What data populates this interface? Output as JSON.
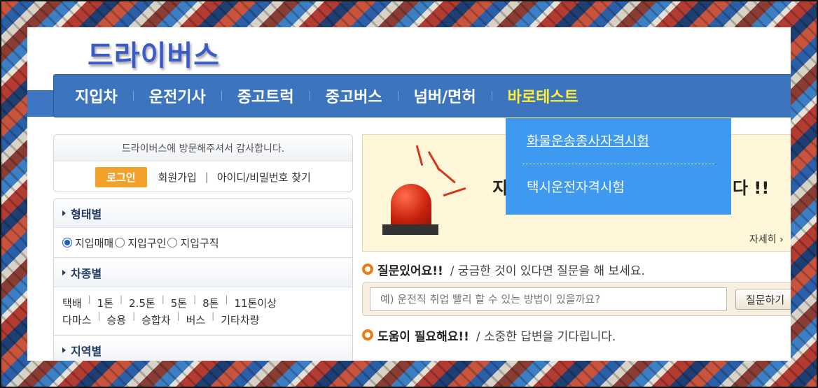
{
  "site": {
    "logo": "드라이버스"
  },
  "nav": {
    "items": [
      "지입차",
      "운전기사",
      "중고트럭",
      "중고버스",
      "넘버/면허",
      "바로테스트"
    ]
  },
  "dropdown": {
    "items": [
      "화물운송종사자격시험",
      "택시운전자격시험"
    ]
  },
  "welcome": {
    "message": "드라이버스에 방문해주셔서 감사합니다.",
    "login": "로그인",
    "join": "회원가입",
    "separator": "|",
    "find": "아이디/비밀번호 찾기"
  },
  "filters": {
    "type_heading": "형태별",
    "type_options": [
      {
        "label": "지입매매",
        "selected": true
      },
      {
        "label": "지입구인",
        "selected": false
      },
      {
        "label": "지입구직",
        "selected": false
      }
    ],
    "vehicle_heading": "차종별",
    "vehicle_row1": [
      "택배",
      "1톤",
      "2.5톤",
      "5톤",
      "8톤",
      "11톤이상"
    ],
    "vehicle_row2": [
      "다마스",
      "승용",
      "승합차",
      "버스",
      "기타차량"
    ],
    "region_heading": "지역별"
  },
  "banner": {
    "title_start": "지",
    "title_end": "다 !!",
    "detail": "자세히 ›"
  },
  "question": {
    "title": "질문있어요!!",
    "desc": "/ 궁금한 것이 있다면 질문을 해 보세요.",
    "placeholder": "예) 운전직 취업 빨리 할 수 있는 방법이 있을까요?",
    "button": "질문하기"
  },
  "help": {
    "title": "도움이 필요해요!!",
    "desc": "/ 소중한 답변을 기다립니다."
  },
  "colors": {
    "nav": "#3d74be",
    "dropdown": "#3d9af0",
    "highlight": "#ffee33",
    "accent": "#f2a12a"
  }
}
